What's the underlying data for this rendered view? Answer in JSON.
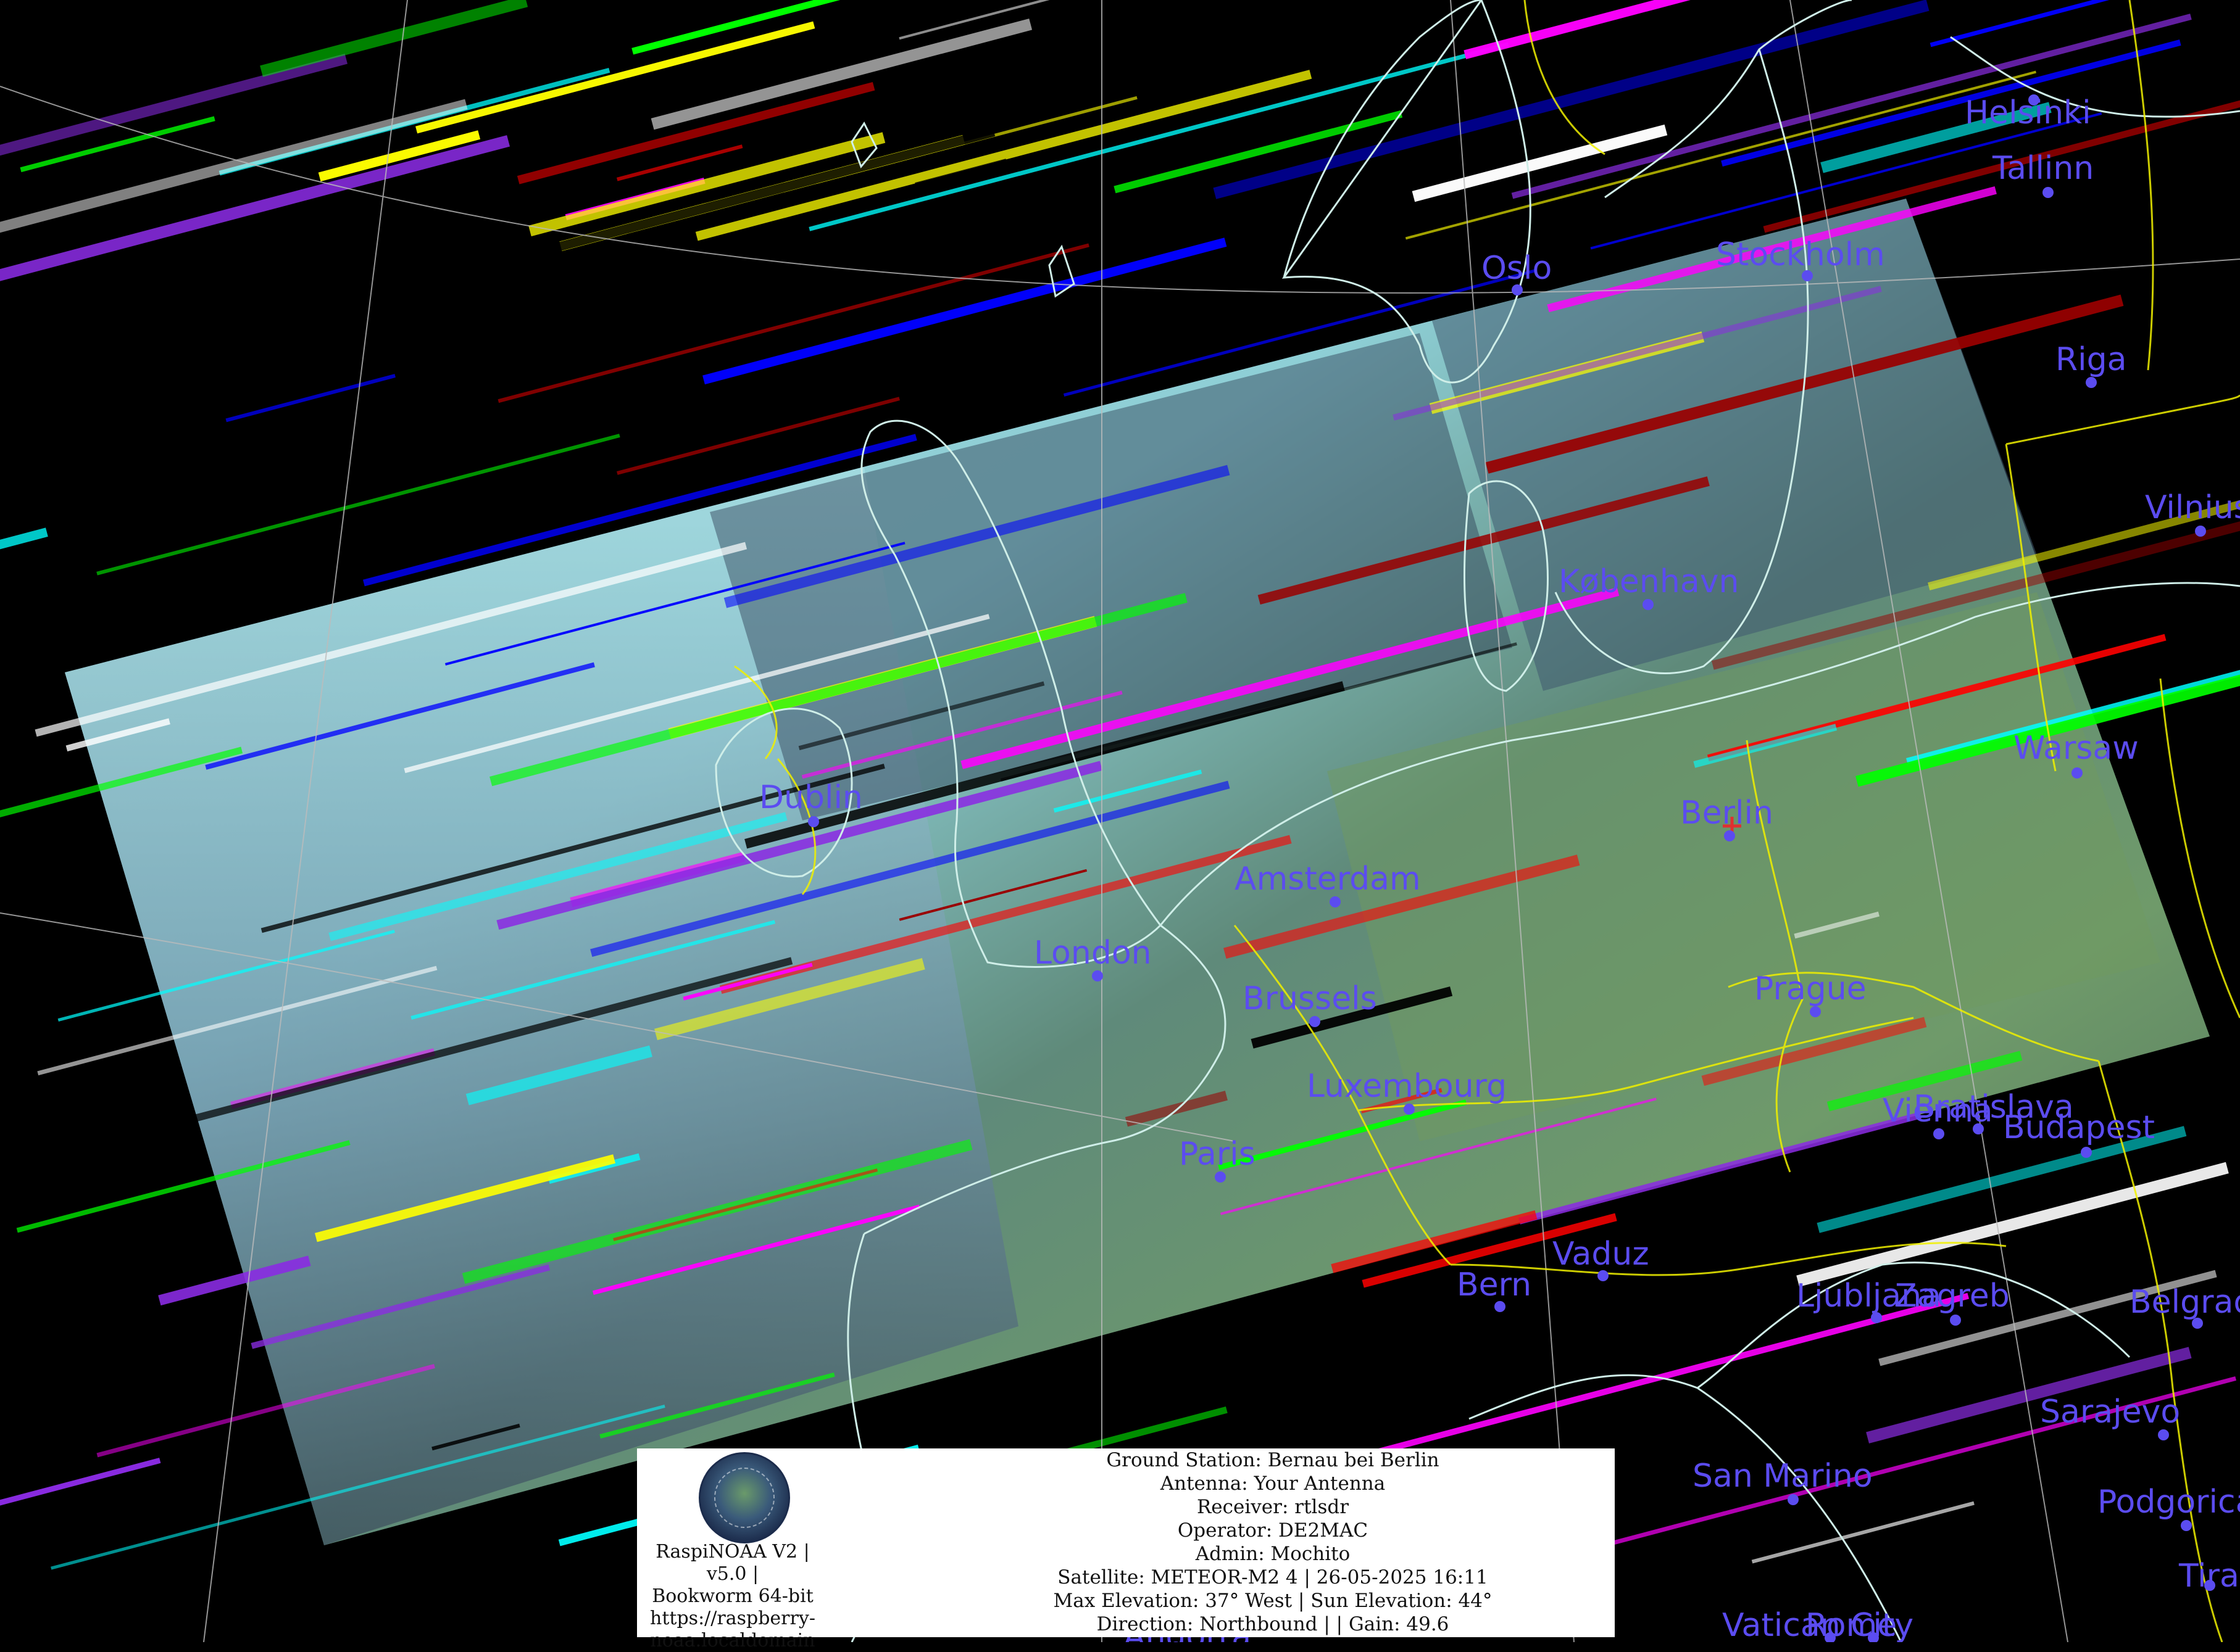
{
  "cities": [
    {
      "name": "Helsinki"
    },
    {
      "name": "Tallinn"
    },
    {
      "name": "Stockholm"
    },
    {
      "name": "Oslo"
    },
    {
      "name": "Riga"
    },
    {
      "name": "Vilnius"
    },
    {
      "name": "København"
    },
    {
      "name": "Warsaw"
    },
    {
      "name": "Dublin"
    },
    {
      "name": "Berlin"
    },
    {
      "name": "Amsterdam"
    },
    {
      "name": "London"
    },
    {
      "name": "Brussels"
    },
    {
      "name": "Prague"
    },
    {
      "name": "Luxembourg"
    },
    {
      "name": "Vienna"
    },
    {
      "name": "Bratislava"
    },
    {
      "name": "Budapest"
    },
    {
      "name": "Paris"
    },
    {
      "name": "Vaduz"
    },
    {
      "name": "Bern"
    },
    {
      "name": "Ljubljana"
    },
    {
      "name": "Zagreb"
    },
    {
      "name": "Belgrade"
    },
    {
      "name": "Sarajevo"
    },
    {
      "name": "San Marino"
    },
    {
      "name": "Podgorica"
    },
    {
      "name": "Tirana"
    },
    {
      "name": "Vatican City"
    },
    {
      "name": "Rome"
    },
    {
      "name": "Andorra"
    }
  ],
  "colors": {
    "city": "#5b4cf0",
    "coastline": "#cfeee8",
    "borders": "#f0f000",
    "graticule": "#bbbbbb",
    "station_marker": "#e03030"
  },
  "info": {
    "software": [
      "RaspiNOAA V2 | v5.0 |",
      "Bookworm 64-bit",
      "https://raspberry-",
      "noaa.localdomain"
    ],
    "station": [
      "Ground Station: Bernau bei Berlin",
      "Antenna: Your Antenna",
      "Receiver: rtlsdr",
      "Operator: DE2MAC",
      "Admin: Mochito",
      "Satellite: METEOR-M2 4 | 26-05-2025 16:11",
      "Max Elevation: 37° West | Sun Elevation: 44°",
      "Direction: Northbound | | Gain: 49.6"
    ]
  }
}
